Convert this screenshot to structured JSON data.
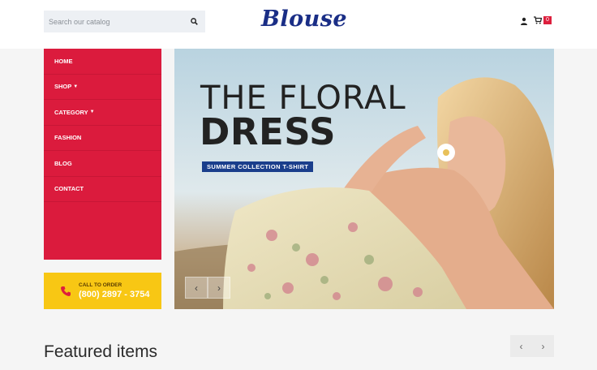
{
  "header": {
    "search": {
      "placeholder": "Search our catalog",
      "value": ""
    },
    "logo": "Blouse",
    "cart_count": "0"
  },
  "menu": {
    "items": [
      {
        "label": "HOME",
        "has_caret": false
      },
      {
        "label": "SHOP",
        "has_caret": true
      },
      {
        "label": "CATEGORY",
        "has_caret": true
      },
      {
        "label": "FASHION",
        "has_caret": false
      },
      {
        "label": "BLOG",
        "has_caret": false
      },
      {
        "label": "CONTACT",
        "has_caret": false
      }
    ]
  },
  "call_box": {
    "label": "CALL TO ORDER",
    "phone": "(800) 2897 - 3754"
  },
  "hero": {
    "title_line1": "THE FLORAL",
    "title_line2": "DRESS",
    "tag": "SUMMER COLLECTION T-SHIRT",
    "prev": "‹",
    "next": "›"
  },
  "featured": {
    "title": "Featured items",
    "prev": "‹",
    "next": "›"
  },
  "colors": {
    "menu_bg": "#db1b3d",
    "call_bg": "#f8c714",
    "logo": "#1a2e86",
    "tag_bg": "#1a3e8c",
    "badge": "#dd1f3d"
  },
  "icons": [
    "search-icon",
    "user-icon",
    "cart-icon",
    "phone-icon"
  ]
}
